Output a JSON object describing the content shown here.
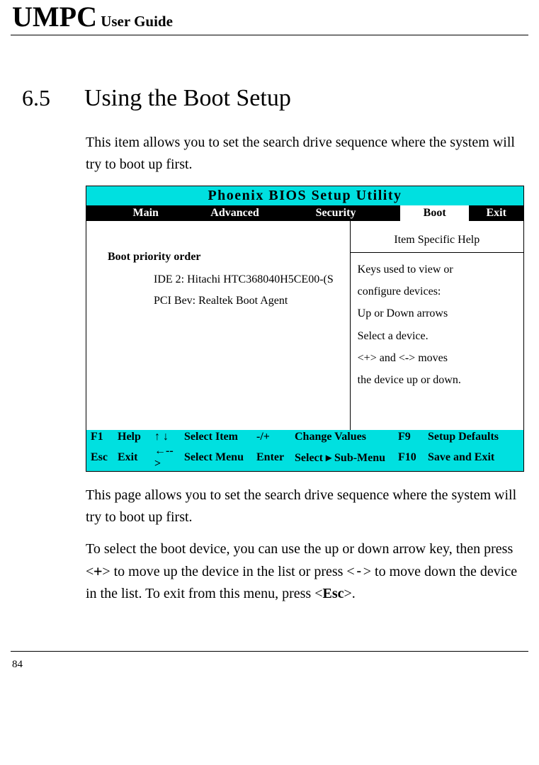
{
  "header": {
    "main": "UMPC",
    "sub": " User Guide"
  },
  "section": {
    "num": "6.5",
    "title": "Using the Boot Setup"
  },
  "intro": "This item allows you to set the search drive sequence where the system will try to boot up first.",
  "bios": {
    "title": "Phoenix BIOS Setup Utility",
    "tabs": {
      "main": "Main",
      "advanced": "Advanced",
      "security": "Security",
      "boot": "Boot",
      "exit": "Exit"
    },
    "boot_label": "Boot priority order",
    "boot_items": [
      "IDE 2: Hitachi HTC368040H5CE00-(S",
      "PCI Bev: Realtek Boot Agent"
    ],
    "help": {
      "header": "Item Specific Help",
      "lines": [
        "Keys used to view or",
        "configure devices:",
        "Up or Down arrows",
        "Select a device.",
        "",
        "<+> and <-> moves",
        "the device up or down."
      ]
    },
    "footer": {
      "c1a": "F1",
      "c1b": "Help",
      "c2a_up": "↑",
      "c2a_down": "↓",
      "c2b": "Select Item",
      "c3a": "-/+",
      "c3b": "Change Values",
      "c4a": "F9",
      "c4b": "Setup Defaults",
      "d1a": "Esc",
      "d1b": "Exit",
      "d2a": "←-->",
      "d2b": "Select Menu",
      "d3a": "Enter",
      "d3b1": "Select",
      "d3b_arrow": "▸",
      "d3b2": "Sub-Menu",
      "d4a": "F10",
      "d4b": "Save and Exit"
    }
  },
  "para2": "This page allows you to set the search drive sequence where the system will try to boot up first.",
  "para3_pre": "To select the boot device, you can use the up or down arrow key, then press <",
  "para3_plus": "+",
  "para3_mid1": "> to move up the device in the list or press <",
  "para3_minus": "-",
  "para3_mid2": "> to move down the device in the list. To exit from this menu, press <",
  "para3_esc": "Esc",
  "para3_end": ">.",
  "page_number": "84"
}
